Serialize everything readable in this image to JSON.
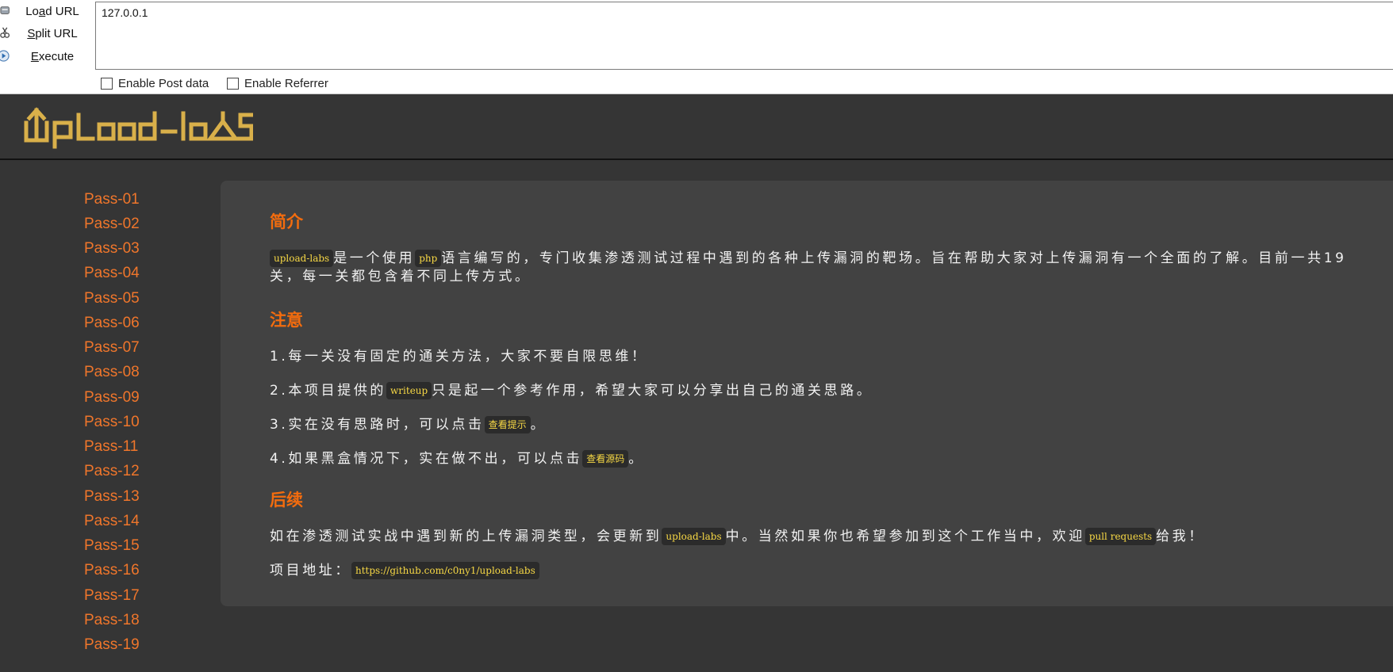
{
  "hackbar": {
    "load_url": {
      "pre": "Lo",
      "key": "a",
      "post": "d URL"
    },
    "split_url": {
      "pre": "",
      "key": "S",
      "post": "plit URL"
    },
    "execute": {
      "pre": "",
      "key": "E",
      "post": "xecute"
    },
    "url_value": "127.0.0.1",
    "enable_post_data": "Enable Post data",
    "enable_referrer": "Enable Referrer"
  },
  "header": {
    "logo_text": "upload-labs",
    "logo_color": "#d9b04a"
  },
  "sidebar": {
    "items": [
      "Pass-01",
      "Pass-02",
      "Pass-03",
      "Pass-04",
      "Pass-05",
      "Pass-06",
      "Pass-07",
      "Pass-08",
      "Pass-09",
      "Pass-10",
      "Pass-11",
      "Pass-12",
      "Pass-13",
      "Pass-14",
      "Pass-15",
      "Pass-16",
      "Pass-17",
      "Pass-18",
      "Pass-19"
    ],
    "link_color": "#f0762b"
  },
  "main": {
    "intro": {
      "title": "简介",
      "code1": "upload-labs",
      "text1": "是一个使用",
      "code2": "php",
      "text2": "语言编写的，专门收集渗透测试过程中遇到的各种上传漏洞的靶场。旨在帮助大家对上传漏洞有一个全面的了解。目前一共19关，每一关都包含着不同上传方式。"
    },
    "notes": {
      "title": "注意",
      "item1": "1.每一关没有固定的通关方法，大家不要自限思维！",
      "item2_pre": "2.本项目提供的",
      "item2_code": "writeup",
      "item2_post": "只是起一个参考作用，希望大家可以分享出自己的通关思路。",
      "item3_pre": "3.实在没有思路时，可以点击",
      "item3_link": "查看提示",
      "item3_post": "。",
      "item4_pre": "4.如果黑盒情况下，实在做不出，可以点击",
      "item4_link": "查看源码",
      "item4_post": "。"
    },
    "followup": {
      "title": "后续",
      "text_pre": "如在渗透测试实战中遇到新的上传漏洞类型，会更新到",
      "code1": "upload-labs",
      "text_mid": "中。当然如果你也希望参加到这个工作当中，欢迎",
      "code2": "pull requests",
      "text_post": "给我！",
      "addr_label": "项目地址：",
      "addr_link": "https://github.com/c0ny1/upload-labs"
    },
    "accent_color": "#f36c0e",
    "code_color": "#f7d845"
  }
}
